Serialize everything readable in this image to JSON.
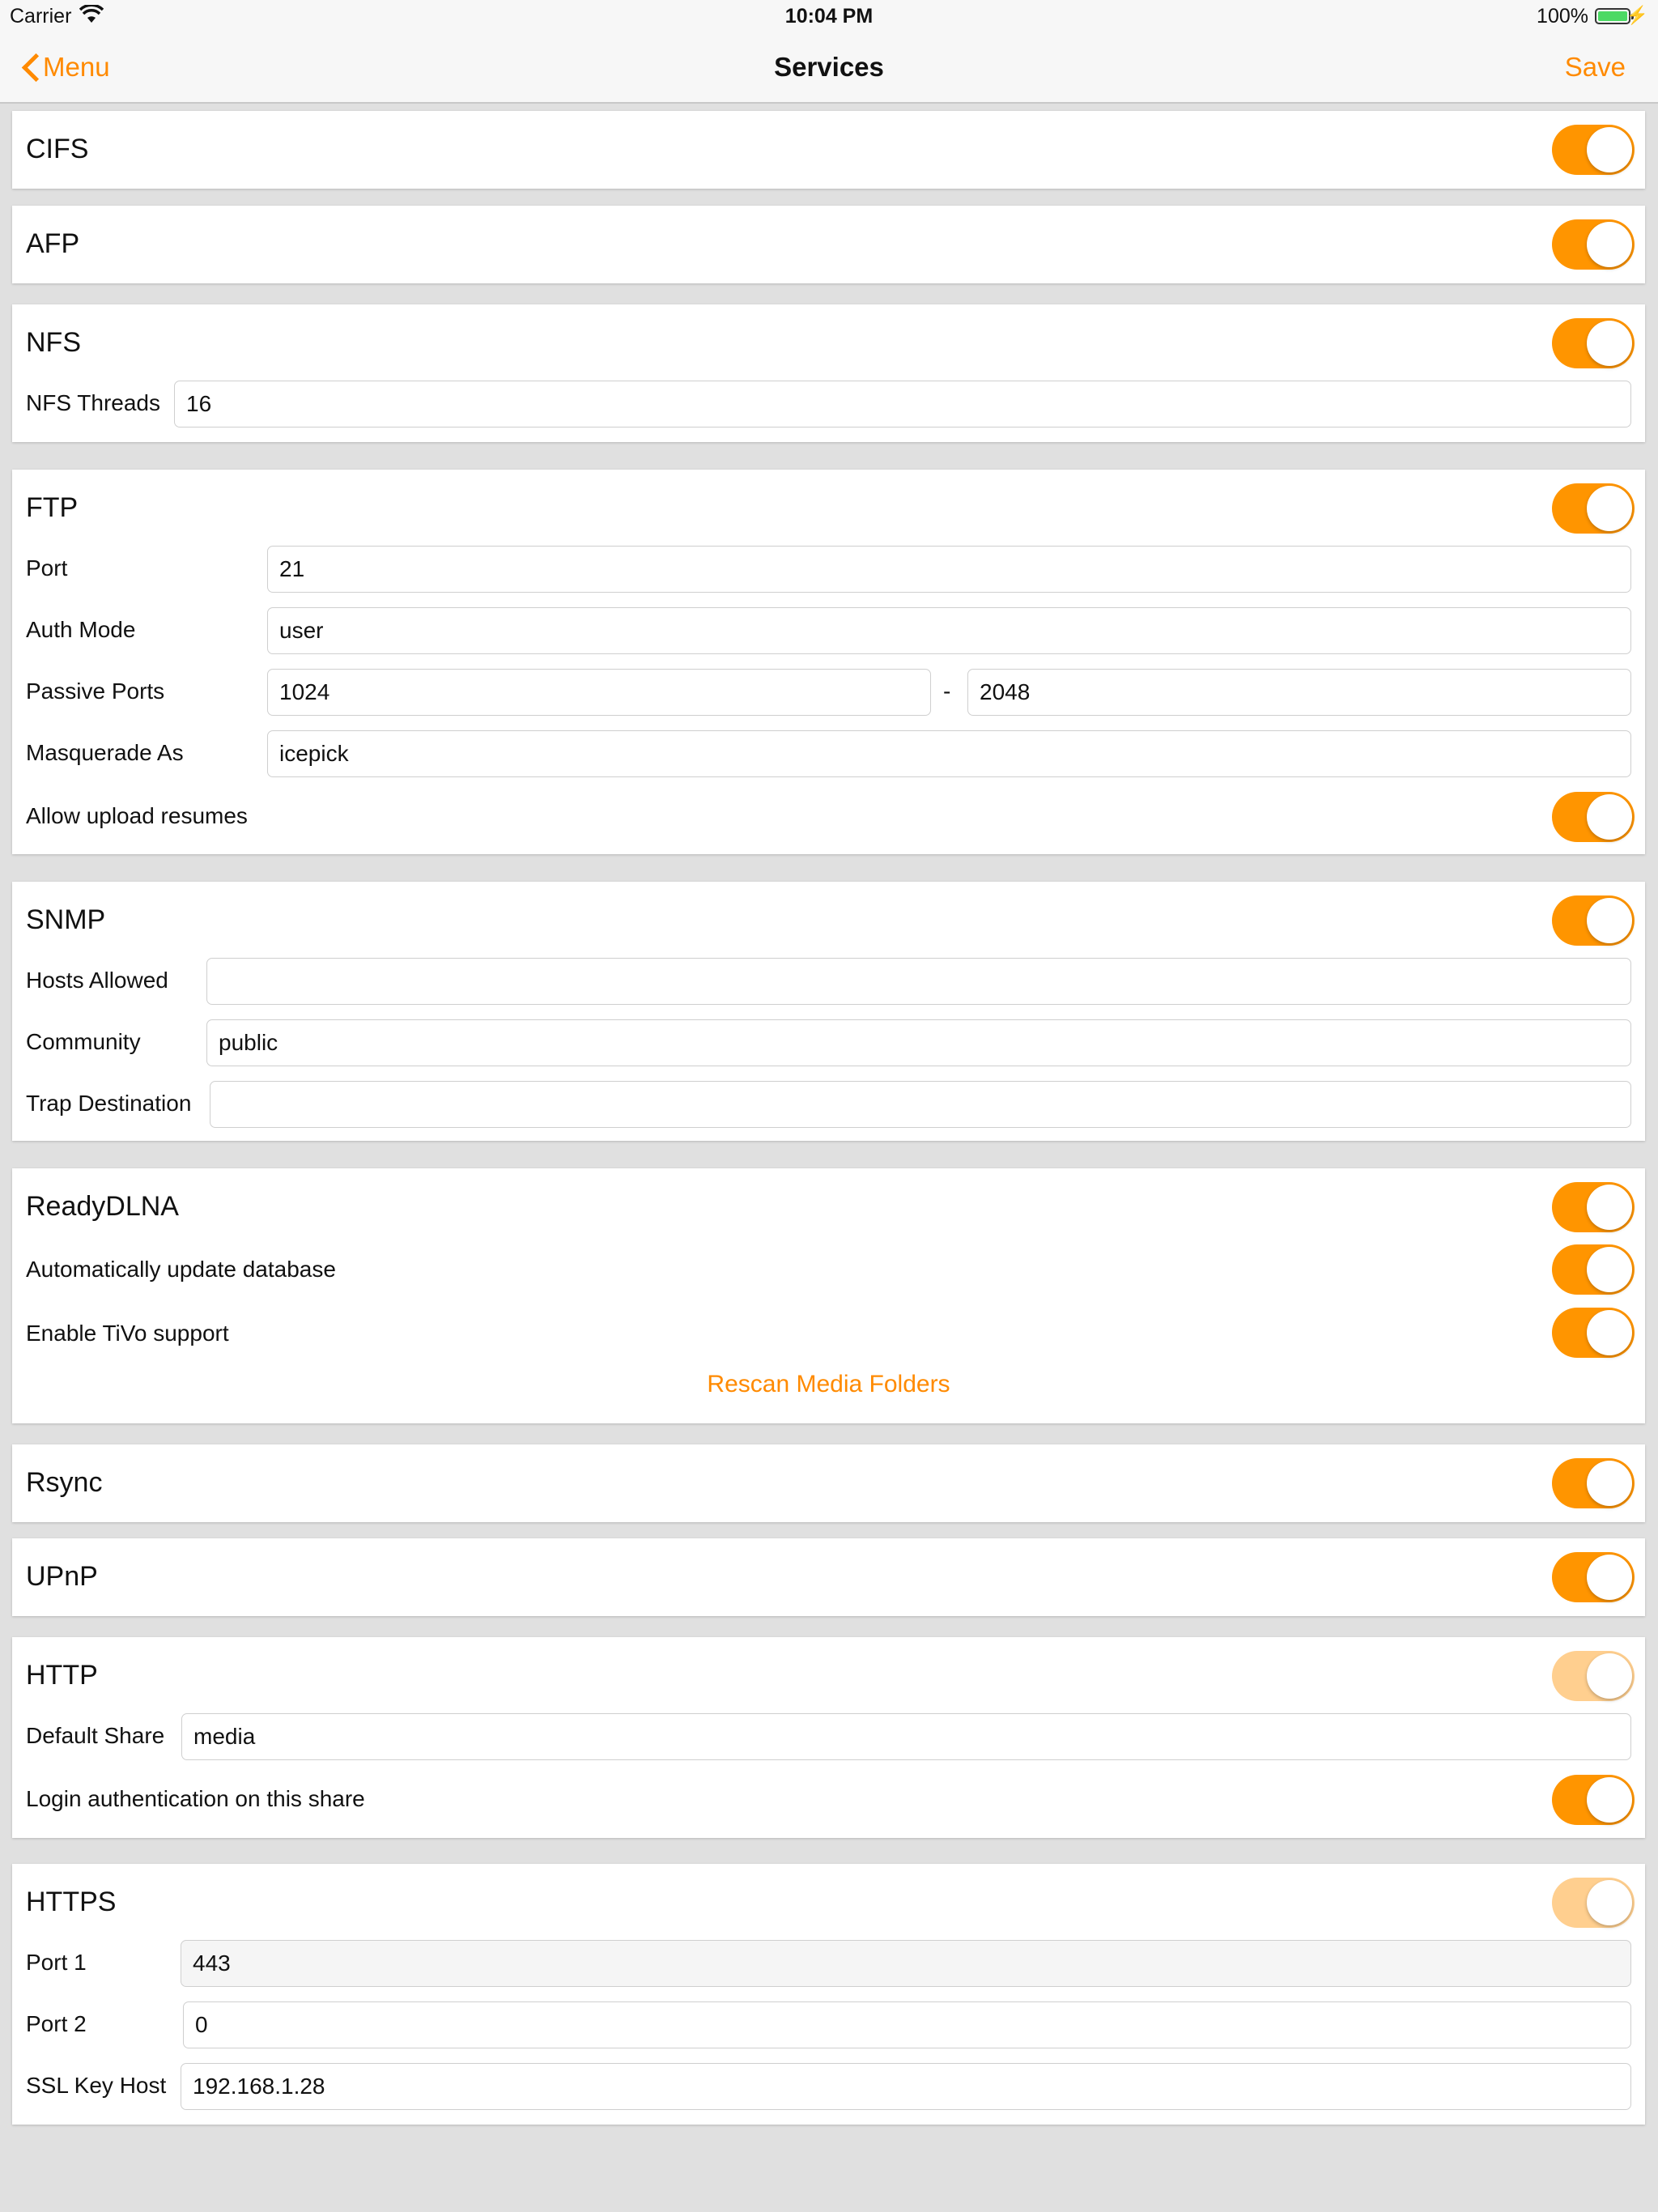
{
  "status": {
    "carrier": "Carrier",
    "time": "10:04 PM",
    "battery": "100%"
  },
  "nav": {
    "back_label": "Menu",
    "title": "Services",
    "save_label": "Save"
  },
  "cifs": {
    "title": "CIFS"
  },
  "afp": {
    "title": "AFP"
  },
  "nfs": {
    "title": "NFS",
    "threads_label": "NFS Threads",
    "threads_value": "16"
  },
  "ftp": {
    "title": "FTP",
    "port_label": "Port",
    "port_value": "21",
    "auth_label": "Auth Mode",
    "auth_value": "user",
    "passive_label": "Passive Ports",
    "passive_from": "1024",
    "passive_sep": "-",
    "passive_to": "2048",
    "masq_label": "Masquerade As",
    "masq_value": "icepick",
    "resume_label": "Allow upload resumes"
  },
  "snmp": {
    "title": "SNMP",
    "hosts_label": "Hosts Allowed",
    "hosts_value": "",
    "community_label": "Community",
    "community_value": "public",
    "trap_label": "Trap Destination",
    "trap_value": ""
  },
  "dlna": {
    "title": "ReadyDLNA",
    "autoupdate_label": "Automatically update database",
    "tivo_label": "Enable TiVo support",
    "rescan_label": "Rescan Media Folders"
  },
  "rsync": {
    "title": "Rsync"
  },
  "upnp": {
    "title": "UPnP"
  },
  "http": {
    "title": "HTTP",
    "share_label": "Default Share",
    "share_value": "media",
    "login_label": "Login authentication on this share"
  },
  "https": {
    "title": "HTTPS",
    "port1_label": "Port 1",
    "port1_value": "443",
    "port2_label": "Port 2",
    "port2_value": "0",
    "ssl_label": "SSL Key Host",
    "ssl_value": "192.168.1.28"
  },
  "colors": {
    "accent": "#ff9500",
    "accent_disabled": "#ffcf8f",
    "background": "#e0e0e0"
  }
}
